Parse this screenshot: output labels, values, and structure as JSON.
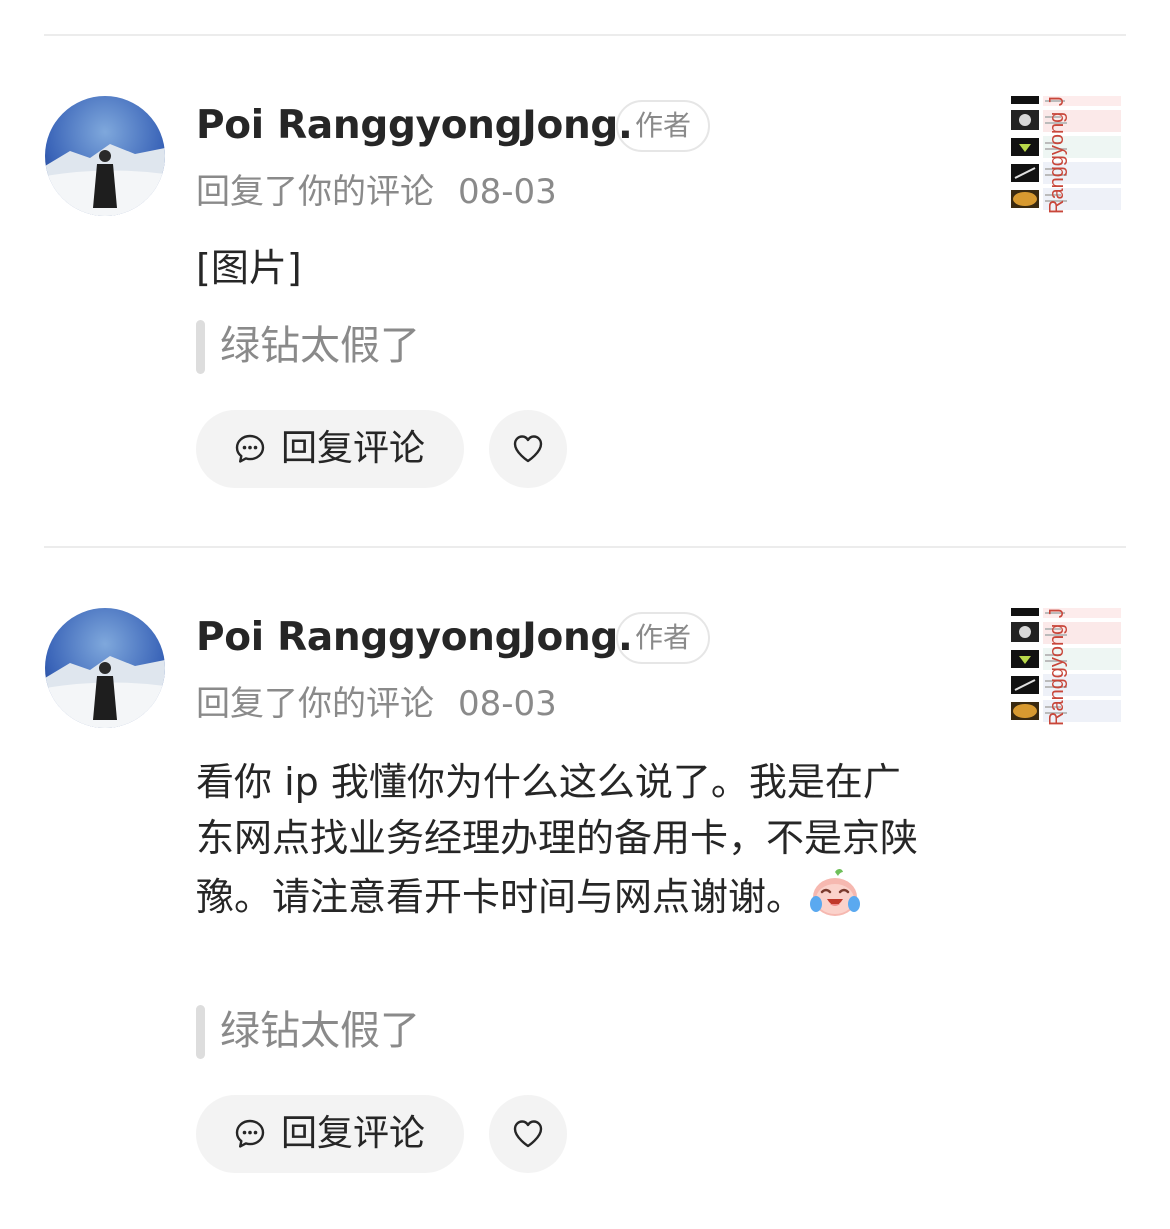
{
  "comments": [
    {
      "author": "Poi RanggyongJong.",
      "badge": "作者",
      "action": "回复了你的评论",
      "date": "08-03",
      "text": "[图片]",
      "quote": "绿钻太假了",
      "reply_label": "回复评论",
      "has_emoji": false
    },
    {
      "author": "Poi RanggyongJong.",
      "badge": "作者",
      "action": "回复了你的评论",
      "date": "08-03",
      "text": "看你 ip 我懂你为什么这么说了。我是在广东网点找业务经理办理的备用卡，不是京陕豫。请注意看开卡时间与网点谢谢。",
      "quote": "绿钻太假了",
      "reply_label": "回复评论",
      "has_emoji": true
    }
  ],
  "thumbnail_watermark": "Ranggyong J",
  "colors": {
    "muted_text": "#8a8a8a",
    "button_bg": "#f3f3f3",
    "divider": "#ececec",
    "watermark": "#c8463a"
  },
  "icons": [
    "comment-bubble-icon",
    "heart-icon",
    "crying-laughing-emoji"
  ]
}
